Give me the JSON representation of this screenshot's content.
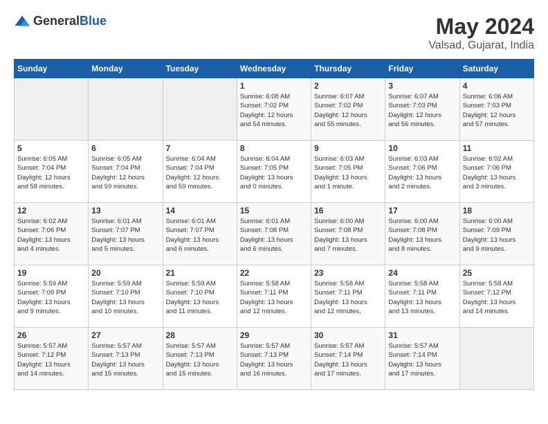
{
  "header": {
    "logo_general": "General",
    "logo_blue": "Blue",
    "title": "May 2024",
    "subtitle": "Valsad, Gujarat, India"
  },
  "weekdays": [
    "Sunday",
    "Monday",
    "Tuesday",
    "Wednesday",
    "Thursday",
    "Friday",
    "Saturday"
  ],
  "weeks": [
    [
      {
        "day": "",
        "empty": true
      },
      {
        "day": "",
        "empty": true
      },
      {
        "day": "",
        "empty": true
      },
      {
        "day": "1",
        "sunrise": "6:08 AM",
        "sunset": "7:02 PM",
        "daylight": "12 hours and 54 minutes."
      },
      {
        "day": "2",
        "sunrise": "6:07 AM",
        "sunset": "7:02 PM",
        "daylight": "12 hours and 55 minutes."
      },
      {
        "day": "3",
        "sunrise": "6:07 AM",
        "sunset": "7:03 PM",
        "daylight": "12 hours and 56 minutes."
      },
      {
        "day": "4",
        "sunrise": "6:06 AM",
        "sunset": "7:03 PM",
        "daylight": "12 hours and 57 minutes."
      }
    ],
    [
      {
        "day": "5",
        "sunrise": "6:05 AM",
        "sunset": "7:04 PM",
        "daylight": "12 hours and 58 minutes."
      },
      {
        "day": "6",
        "sunrise": "6:05 AM",
        "sunset": "7:04 PM",
        "daylight": "12 hours and 59 minutes."
      },
      {
        "day": "7",
        "sunrise": "6:04 AM",
        "sunset": "7:04 PM",
        "daylight": "12 hours and 59 minutes."
      },
      {
        "day": "8",
        "sunrise": "6:04 AM",
        "sunset": "7:05 PM",
        "daylight": "13 hours and 0 minutes."
      },
      {
        "day": "9",
        "sunrise": "6:03 AM",
        "sunset": "7:05 PM",
        "daylight": "13 hours and 1 minute."
      },
      {
        "day": "10",
        "sunrise": "6:03 AM",
        "sunset": "7:06 PM",
        "daylight": "13 hours and 2 minutes."
      },
      {
        "day": "11",
        "sunrise": "6:02 AM",
        "sunset": "7:06 PM",
        "daylight": "13 hours and 3 minutes."
      }
    ],
    [
      {
        "day": "12",
        "sunrise": "6:02 AM",
        "sunset": "7:06 PM",
        "daylight": "13 hours and 4 minutes."
      },
      {
        "day": "13",
        "sunrise": "6:01 AM",
        "sunset": "7:07 PM",
        "daylight": "13 hours and 5 minutes."
      },
      {
        "day": "14",
        "sunrise": "6:01 AM",
        "sunset": "7:07 PM",
        "daylight": "13 hours and 6 minutes."
      },
      {
        "day": "15",
        "sunrise": "6:01 AM",
        "sunset": "7:08 PM",
        "daylight": "13 hours and 6 minutes."
      },
      {
        "day": "16",
        "sunrise": "6:00 AM",
        "sunset": "7:08 PM",
        "daylight": "13 hours and 7 minutes."
      },
      {
        "day": "17",
        "sunrise": "6:00 AM",
        "sunset": "7:08 PM",
        "daylight": "13 hours and 8 minutes."
      },
      {
        "day": "18",
        "sunrise": "6:00 AM",
        "sunset": "7:09 PM",
        "daylight": "13 hours and 9 minutes."
      }
    ],
    [
      {
        "day": "19",
        "sunrise": "5:59 AM",
        "sunset": "7:09 PM",
        "daylight": "13 hours and 9 minutes."
      },
      {
        "day": "20",
        "sunrise": "5:59 AM",
        "sunset": "7:10 PM",
        "daylight": "13 hours and 10 minutes."
      },
      {
        "day": "21",
        "sunrise": "5:59 AM",
        "sunset": "7:10 PM",
        "daylight": "13 hours and 11 minutes."
      },
      {
        "day": "22",
        "sunrise": "5:58 AM",
        "sunset": "7:11 PM",
        "daylight": "13 hours and 12 minutes."
      },
      {
        "day": "23",
        "sunrise": "5:58 AM",
        "sunset": "7:11 PM",
        "daylight": "13 hours and 12 minutes."
      },
      {
        "day": "24",
        "sunrise": "5:58 AM",
        "sunset": "7:11 PM",
        "daylight": "13 hours and 13 minutes."
      },
      {
        "day": "25",
        "sunrise": "5:58 AM",
        "sunset": "7:12 PM",
        "daylight": "13 hours and 14 minutes."
      }
    ],
    [
      {
        "day": "26",
        "sunrise": "5:57 AM",
        "sunset": "7:12 PM",
        "daylight": "13 hours and 14 minutes."
      },
      {
        "day": "27",
        "sunrise": "5:57 AM",
        "sunset": "7:13 PM",
        "daylight": "13 hours and 15 minutes."
      },
      {
        "day": "28",
        "sunrise": "5:57 AM",
        "sunset": "7:13 PM",
        "daylight": "13 hours and 15 minutes."
      },
      {
        "day": "29",
        "sunrise": "5:57 AM",
        "sunset": "7:13 PM",
        "daylight": "13 hours and 16 minutes."
      },
      {
        "day": "30",
        "sunrise": "5:57 AM",
        "sunset": "7:14 PM",
        "daylight": "13 hours and 17 minutes."
      },
      {
        "day": "31",
        "sunrise": "5:57 AM",
        "sunset": "7:14 PM",
        "daylight": "13 hours and 17 minutes."
      },
      {
        "day": "",
        "empty": true
      }
    ]
  ]
}
